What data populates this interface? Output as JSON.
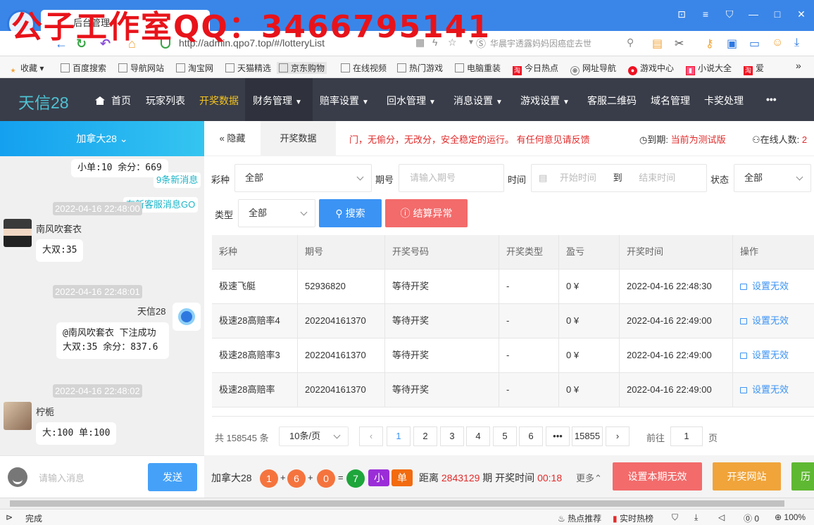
{
  "browser": {
    "watermark": "公子工作室QQ：3466795141",
    "tab_title": "后台管理",
    "url": "http://admin.qpo7.top/#/lotteryList",
    "search_hint": "华晨宇透露妈妈因癌症去世",
    "bookmarks": [
      "收藏",
      "百度搜索",
      "导航网站",
      "淘宝网",
      "天猫精选",
      "京东购物",
      "在线视频",
      "热门游戏",
      "电脑重装",
      "今日热点",
      "网址导航",
      "游戏中心",
      "小说大全",
      "爱"
    ],
    "status_text": "完成",
    "status_hot": "热点推荐",
    "status_realtime": "实时热榜",
    "status_count": "0",
    "status_zoom": "100%"
  },
  "nav": {
    "brand": "天信28",
    "items": [
      {
        "label": "首页",
        "caret": ""
      },
      {
        "label": "玩家列表",
        "caret": ""
      },
      {
        "label": "开奖数据",
        "caret": ""
      },
      {
        "label": "财务管理",
        "caret": "▼"
      },
      {
        "label": "赔率设置",
        "caret": "▼"
      },
      {
        "label": "回水管理",
        "caret": "▼"
      },
      {
        "label": "消息设置",
        "caret": "▼"
      },
      {
        "label": "游戏设置",
        "caret": "▼"
      },
      {
        "label": "客服二维码",
        "caret": ""
      },
      {
        "label": "域名管理",
        "caret": ""
      },
      {
        "label": "卡奖处理",
        "caret": ""
      },
      {
        "label": "•••",
        "caret": ""
      }
    ]
  },
  "chat": {
    "game": "加拿大28",
    "game_caret": "⌄",
    "msg_top": "小单:10 余分：669",
    "new_msgs": "9条新消息",
    "service_msg": "有新客服消息GO",
    "messages": [
      {
        "time": "2022-04-16 22:48:00",
        "user": "南风吹套衣",
        "text": "大双:35"
      },
      {
        "time": "2022-04-16 22:48:01",
        "user": "天信28",
        "text1": "@南风吹套衣 下注成功",
        "text2": "大双:35 余分：837.6"
      },
      {
        "time": "2022-04-16 22:48:02",
        "user": "柠栀",
        "text": "大:100 单:100"
      }
    ],
    "input_placeholder": "请输入消息",
    "send_label": "发送"
  },
  "header": {
    "hide_label": "隐藏",
    "tab_label": "开奖数据",
    "marquee": "门，无偷分，无改分，安全稳定的运行。 有任何意见请反馈",
    "expire_label": "到期:",
    "expire_value": "当前为测试版",
    "online_label": "在线人数:",
    "online_value": "2"
  },
  "filters": {
    "lottery_label": "彩种",
    "lottery_value": "全部",
    "period_label": "期号",
    "period_placeholder": "请输入期号",
    "time_label": "时间",
    "time_start": "开始时间",
    "time_to": "到",
    "time_end": "结束时间",
    "status_label": "状态",
    "status_value": "全部",
    "type_label": "类型",
    "type_value": "全部",
    "search_label": "搜索",
    "error_label": "结算异常"
  },
  "table": {
    "headers": [
      "彩种",
      "期号",
      "开奖号码",
      "开奖类型",
      "盈亏",
      "开奖时间",
      "操作"
    ],
    "rows": [
      [
        "极速飞艇",
        "52936820",
        "等待开奖",
        "-",
        "0 ¥",
        "2022-04-16 22:48:30",
        "设置无效"
      ],
      [
        "极速28高赔率4",
        "202204161370",
        "等待开奖",
        "-",
        "0 ¥",
        "2022-04-16 22:49:00",
        "设置无效"
      ],
      [
        "极速28高赔率3",
        "202204161370",
        "等待开奖",
        "-",
        "0 ¥",
        "2022-04-16 22:49:00",
        "设置无效"
      ],
      [
        "极速28高赔率",
        "202204161370",
        "等待开奖",
        "-",
        "0 ¥",
        "2022-04-16 22:49:00",
        "设置无效"
      ]
    ]
  },
  "pager": {
    "total": "共 158545 条",
    "page_size": "10条/页",
    "prev": "‹",
    "pages": [
      "1",
      "2",
      "3",
      "4",
      "5",
      "6",
      "•••",
      "15855"
    ],
    "next": "›",
    "goto_label": "前往",
    "goto_value": "1",
    "page_suffix": "页"
  },
  "bottom": {
    "game": "加拿大28",
    "balls": [
      "1",
      "6",
      "0",
      "7"
    ],
    "plus": "+",
    "eq": "=",
    "tag_small": "小",
    "tag_odd": "单",
    "distance_label": "距离",
    "distance_value": "2843129",
    "period_unit": "期 开奖时间",
    "countdown": "00:18",
    "more": "更多⌃",
    "btn_invalid": "设置本期无效",
    "btn_open_site": "开奖网站",
    "btn_history": "历"
  },
  "colors": {
    "nav_bg": "#393d49",
    "nav_active": "#f4c31f",
    "brand": "#4fc3d4",
    "primary": "#3b93f4",
    "danger": "#f36b6b",
    "orange": "#f0a43a",
    "green": "#5fb832"
  }
}
